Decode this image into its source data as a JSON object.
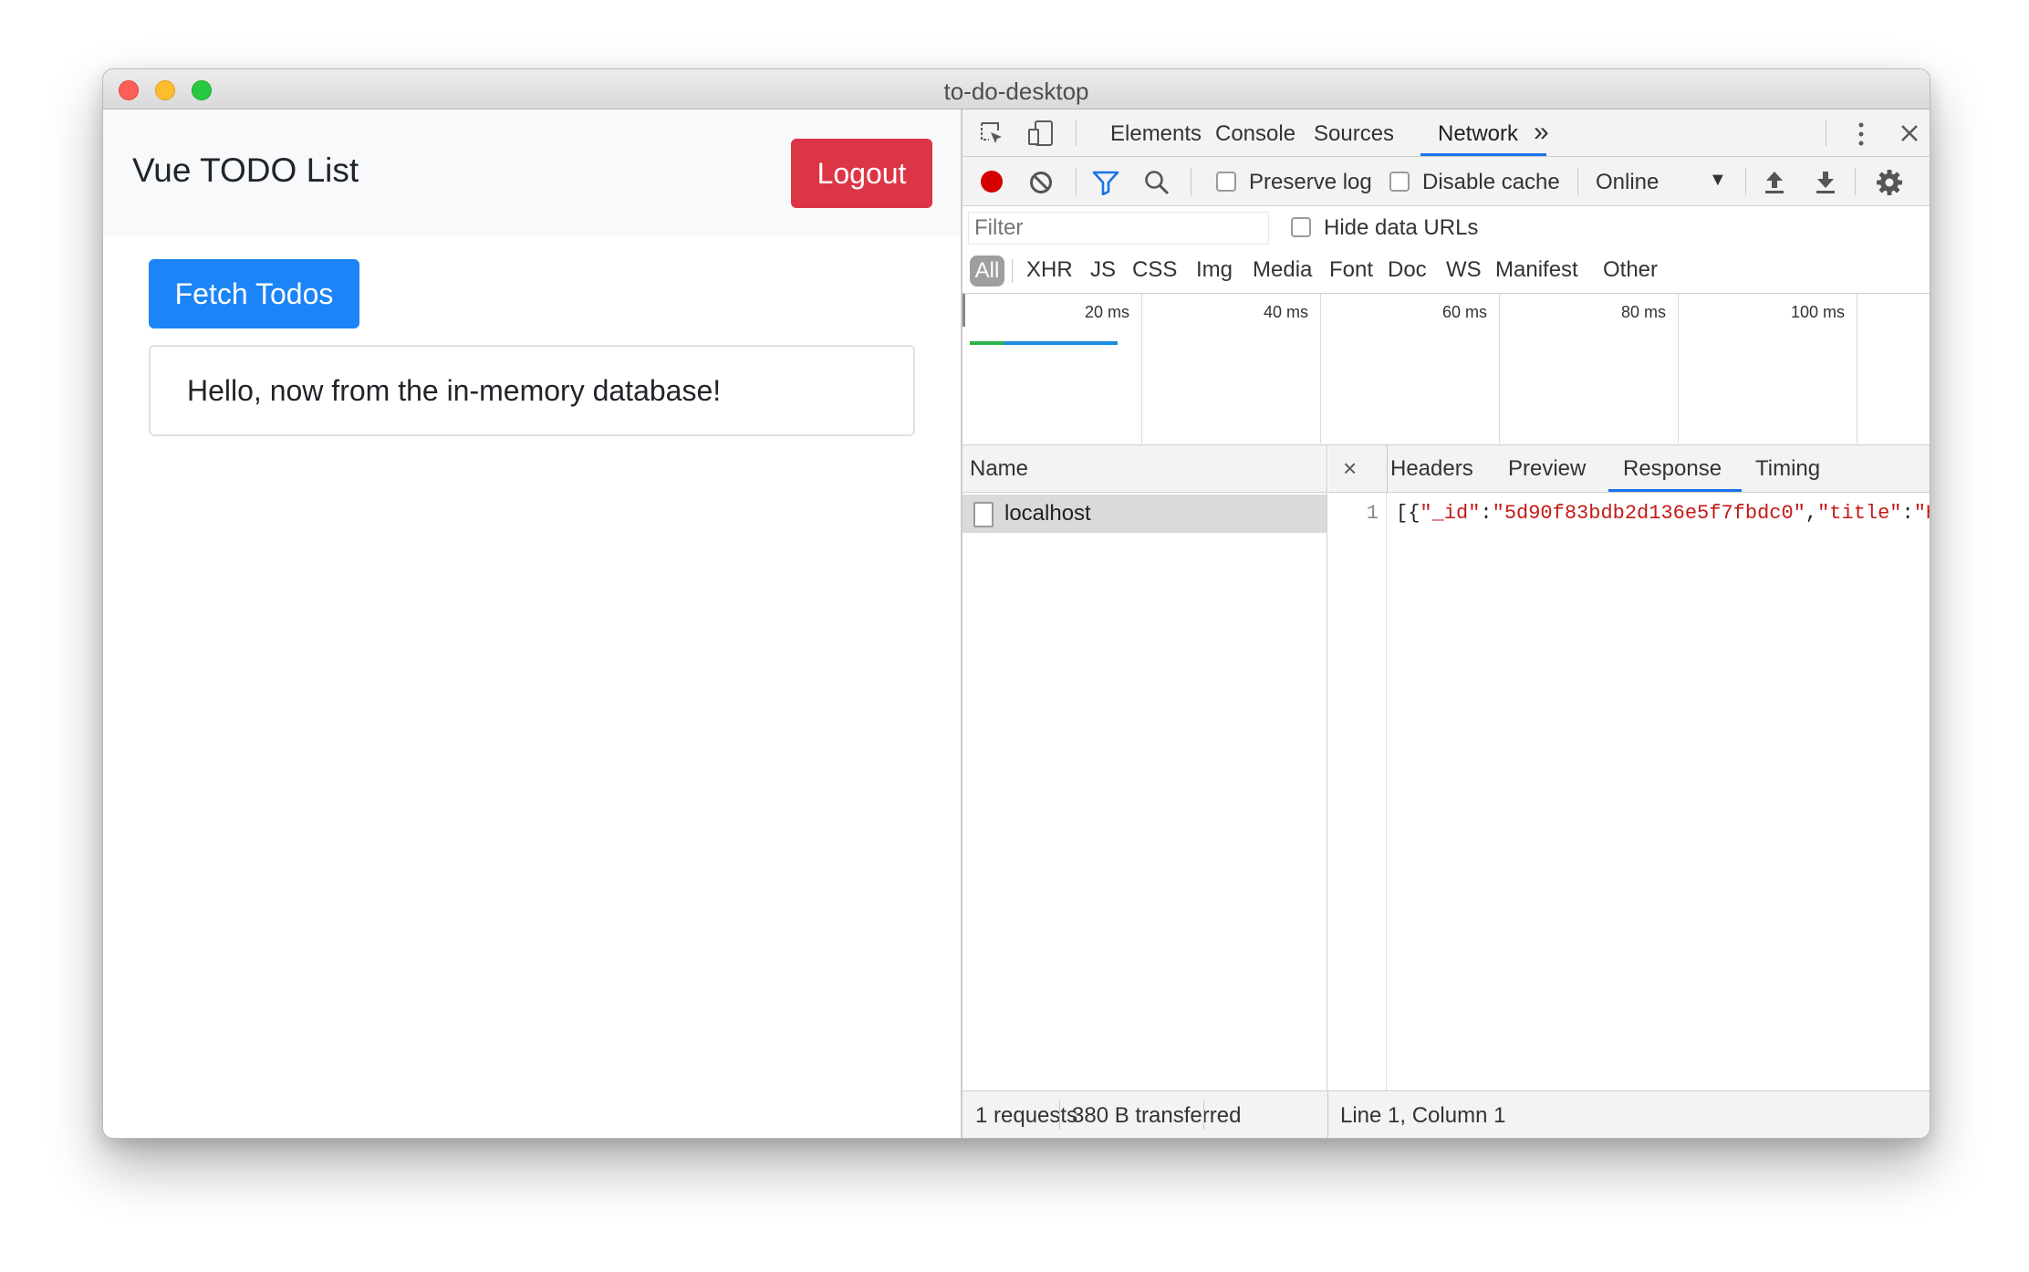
{
  "window": {
    "title": "to-do-desktop"
  },
  "app": {
    "brand": "Vue TODO List",
    "logout_label": "Logout",
    "fetch_label": "Fetch Todos",
    "todo_items": [
      "Hello, now from the in-memory database!"
    ]
  },
  "devtools": {
    "tabs": [
      "Elements",
      "Console",
      "Sources",
      "Network"
    ],
    "active_tab": "Network",
    "more_tabs": "»",
    "toolbar": {
      "preserve_log": "Preserve log",
      "disable_cache": "Disable cache",
      "throttling": "Online"
    },
    "filter": {
      "placeholder": "Filter",
      "hide_data_urls": "Hide data URLs",
      "types": [
        "All",
        "XHR",
        "JS",
        "CSS",
        "Img",
        "Media",
        "Font",
        "Doc",
        "WS",
        "Manifest",
        "Other"
      ]
    },
    "overview": {
      "ticks": [
        "20 ms",
        "40 ms",
        "60 ms",
        "80 ms",
        "100 ms"
      ]
    },
    "requests": {
      "header": "Name",
      "rows": [
        "localhost"
      ]
    },
    "detail": {
      "close": "×",
      "tabs": [
        "Headers",
        "Preview",
        "Response",
        "Timing"
      ],
      "active_tab": "Response",
      "line_number": "1",
      "code_prefix": "[{",
      "code_key1": "\"_id\"",
      "code_colon1": ":",
      "code_val1": "\"5d90f83bdb2d136e5f7fbdc0\"",
      "code_comma": ",",
      "code_key2": "\"title\"",
      "code_colon2": ":",
      "code_val2": "\"Hello, now from the in-memory database!\"}]"
    },
    "status": {
      "requests": "1 requests",
      "transferred": "380 B transferred",
      "cursor": "Line 1, Column 1"
    }
  },
  "colors": {
    "danger": "#dc3545",
    "primary": "#1b84f6",
    "accent": "#1a73e8",
    "record": "#d40000"
  }
}
